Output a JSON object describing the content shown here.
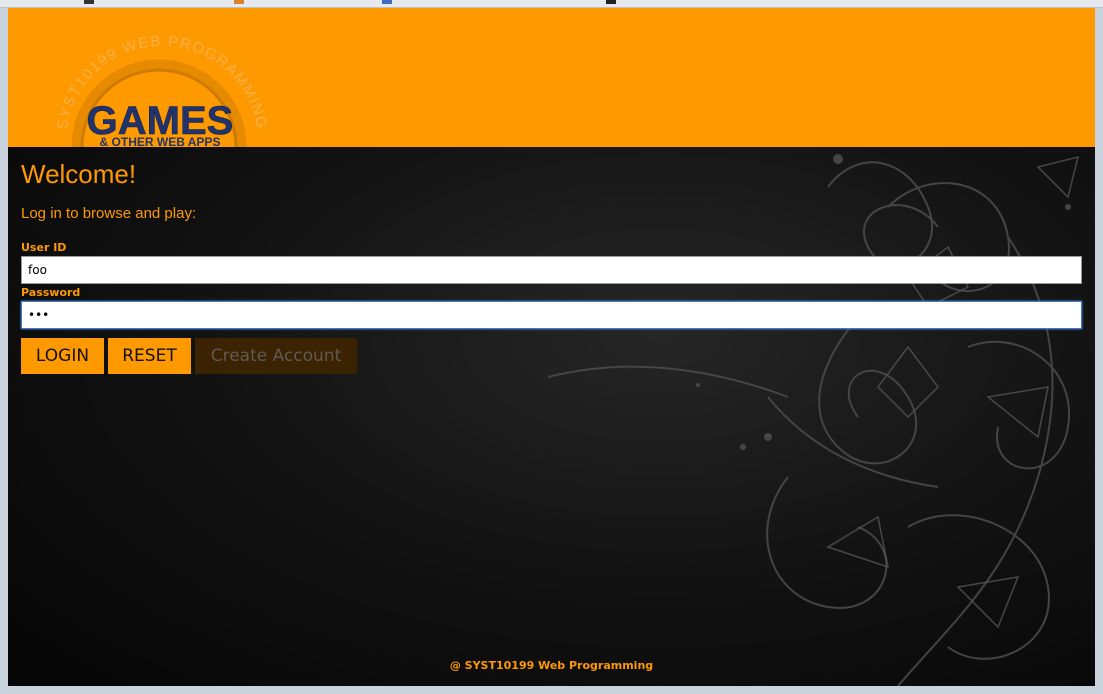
{
  "header": {
    "logo": {
      "arc_text": "SYST10199 WEB PROGRAMMING",
      "title": "GAMES",
      "subtitle": "& OTHER WEB APPS"
    }
  },
  "main": {
    "welcome": "Welcome!",
    "intro": "Log in to browse and play:",
    "user_id_label": "User ID",
    "user_id_value": "foo",
    "password_label": "Password",
    "password_value": "•••",
    "buttons": {
      "login": "LOGIN",
      "reset": "RESET",
      "create_account": "Create Account"
    }
  },
  "footer": {
    "text": "@ SYST10199 Web Programming"
  },
  "colors": {
    "accent": "#ff9900",
    "logo_text": "#22336b",
    "background": "#0c0c0c",
    "disabled_button": "#3b2200"
  }
}
